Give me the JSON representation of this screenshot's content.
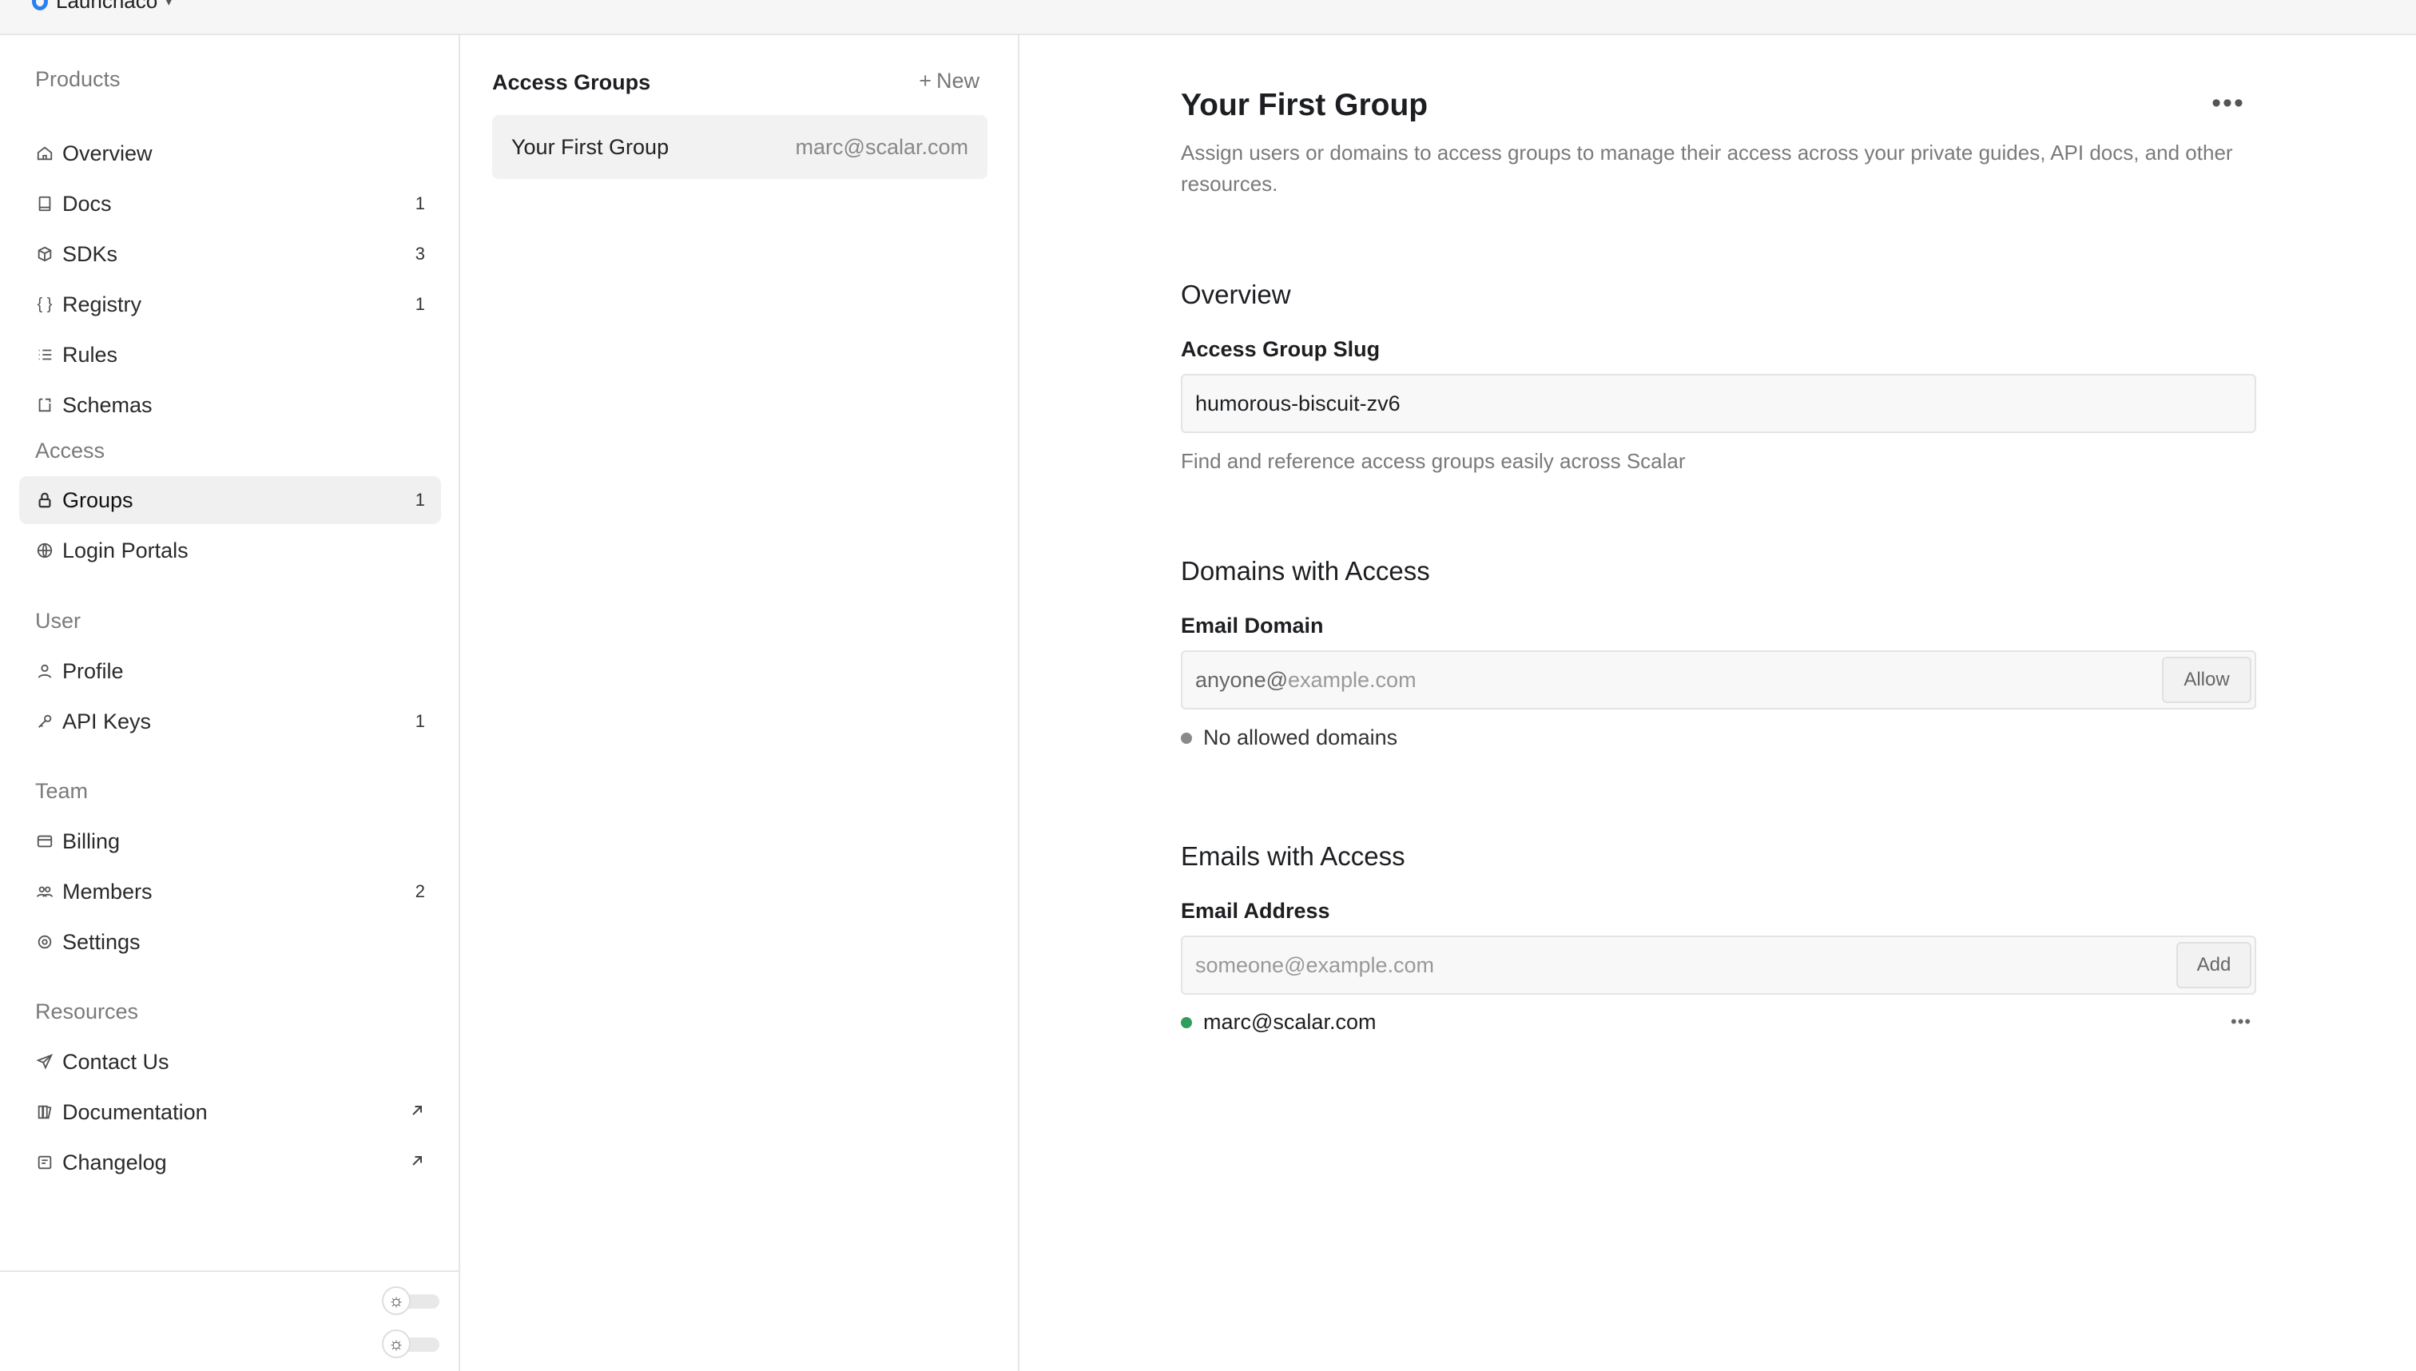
{
  "topbar": {
    "team_name": "Launchaco"
  },
  "sidebar": {
    "sections": [
      {
        "title": "Products"
      },
      {
        "title": "Access"
      },
      {
        "title": "User"
      },
      {
        "title": "Team"
      },
      {
        "title": "Resources"
      }
    ],
    "items": [
      {
        "label": "Overview",
        "count": "",
        "icon": "home-icon"
      },
      {
        "label": "Docs",
        "count": "1",
        "icon": "book-icon"
      },
      {
        "label": "SDKs",
        "count": "3",
        "icon": "cube-icon"
      },
      {
        "label": "Registry",
        "count": "1",
        "icon": "braces-icon"
      },
      {
        "label": "Rules",
        "count": "",
        "icon": "list-icon"
      },
      {
        "label": "Schemas",
        "count": "",
        "icon": "schema-icon"
      },
      {
        "label": "Groups",
        "count": "1",
        "icon": "lock-icon",
        "active": true
      },
      {
        "label": "Login Portals",
        "count": "",
        "icon": "globe-icon"
      },
      {
        "label": "Profile",
        "count": "",
        "icon": "user-icon"
      },
      {
        "label": "API Keys",
        "count": "1",
        "icon": "key-icon"
      },
      {
        "label": "Billing",
        "count": "",
        "icon": "card-icon"
      },
      {
        "label": "Members",
        "count": "2",
        "icon": "users-icon"
      },
      {
        "label": "Settings",
        "count": "",
        "icon": "gear-icon"
      },
      {
        "label": "Contact Us",
        "count": "",
        "icon": "send-icon"
      },
      {
        "label": "Documentation",
        "count": "",
        "icon": "books-icon",
        "external": true
      },
      {
        "label": "Changelog",
        "count": "",
        "icon": "note-icon",
        "external": true
      }
    ]
  },
  "groups_panel": {
    "title": "Access Groups",
    "new_label": "New",
    "groups": [
      {
        "name": "Your First Group",
        "owner": "marc@scalar.com"
      }
    ]
  },
  "main": {
    "title": "Your First Group",
    "description": "Assign users or domains to access groups to manage their access across your private guides, API docs, and other resources.",
    "overview": {
      "heading": "Overview",
      "slug_label": "Access Group Slug",
      "slug_value": "humorous-biscuit-zv6",
      "slug_hint": "Find and reference access groups easily across Scalar"
    },
    "domains": {
      "heading": "Domains with Access",
      "field_label": "Email Domain",
      "prefix": "anyone@",
      "placeholder": "example.com",
      "button": "Allow",
      "empty_text": "No allowed domains"
    },
    "emails": {
      "heading": "Emails with Access",
      "field_label": "Email Address",
      "placeholder": "someone@example.com",
      "button": "Add",
      "entries": [
        "marc@scalar.com"
      ]
    }
  },
  "colors": {
    "accent": "#2b7ff0",
    "status_green": "#2f9e5b",
    "status_gray": "#8a8a8a"
  }
}
